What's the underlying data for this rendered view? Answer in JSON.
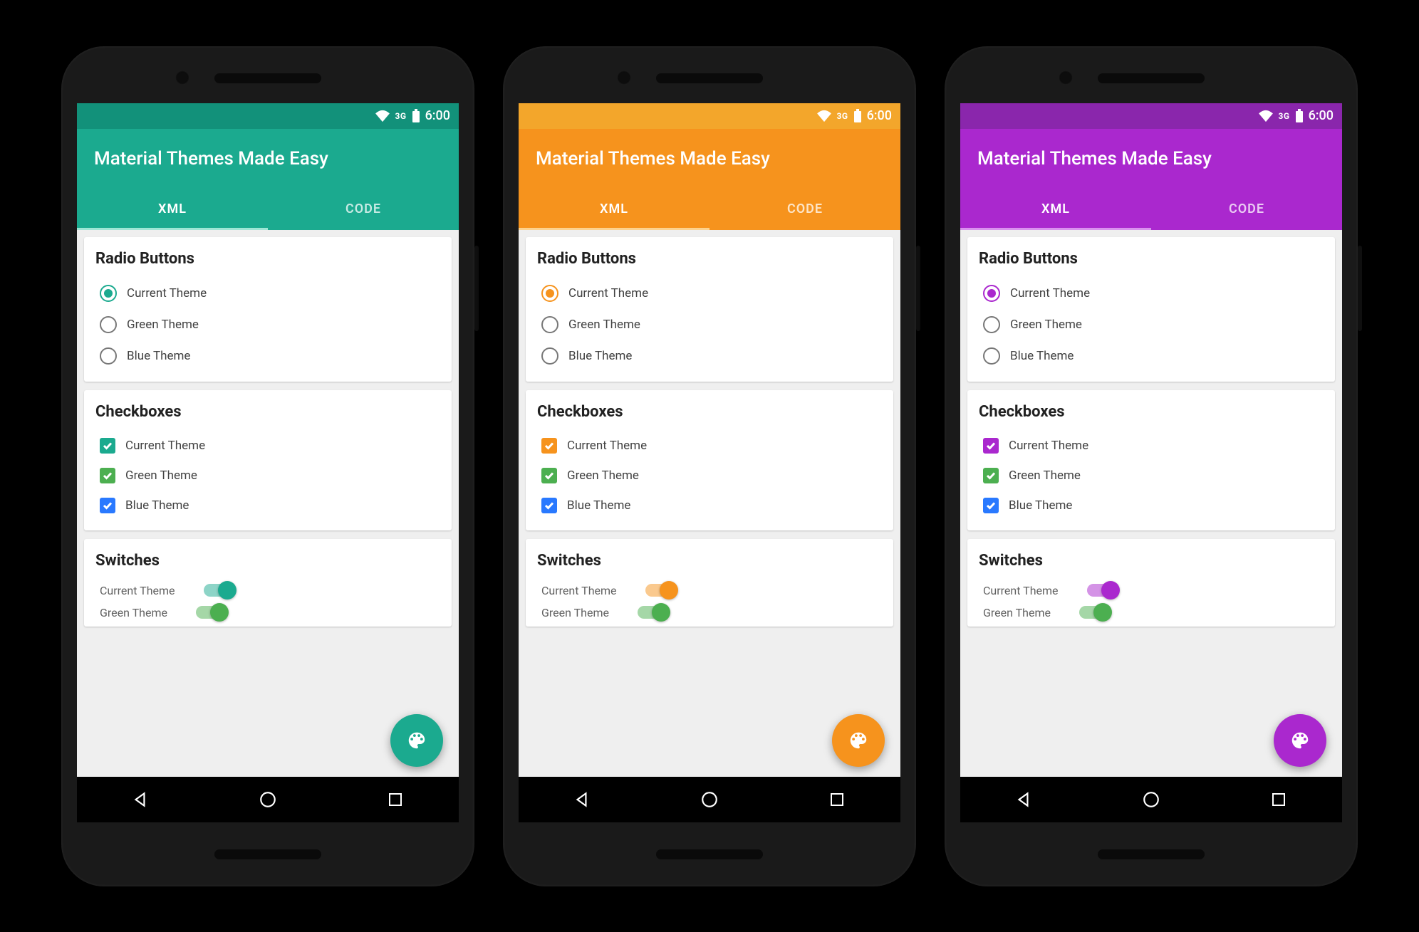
{
  "status": {
    "network": "3G",
    "time": "6:00"
  },
  "app": {
    "title": "Material Themes Made Easy"
  },
  "tabs": {
    "xml": "XML",
    "code": "CODE"
  },
  "sections": {
    "radio": {
      "title": "Radio Buttons",
      "items": [
        "Current Theme",
        "Green Theme",
        "Blue Theme"
      ]
    },
    "checkbox": {
      "title": "Checkboxes",
      "items": [
        "Current Theme",
        "Green Theme",
        "Blue Theme"
      ]
    },
    "switches": {
      "title": "Switches",
      "items": [
        "Current Theme",
        "Green Theme"
      ]
    }
  },
  "colors": {
    "green_checkbox": "#4CAF50",
    "blue_checkbox": "#2979FF",
    "green_switch": "#4CAF50"
  },
  "phones": [
    {
      "accent": "#1BAA8F",
      "statusbar": "#12917A",
      "appbar": "#1BAA8F",
      "tab_indicator": "#9EE6D5"
    },
    {
      "accent": "#F6931D",
      "statusbar": "#F3A62B",
      "appbar": "#F6931D",
      "tab_indicator": "#FDD28E"
    },
    {
      "accent": "#AA28CE",
      "statusbar": "#8A26AC",
      "appbar": "#AA28CE",
      "tab_indicator": "#D991EE"
    }
  ]
}
